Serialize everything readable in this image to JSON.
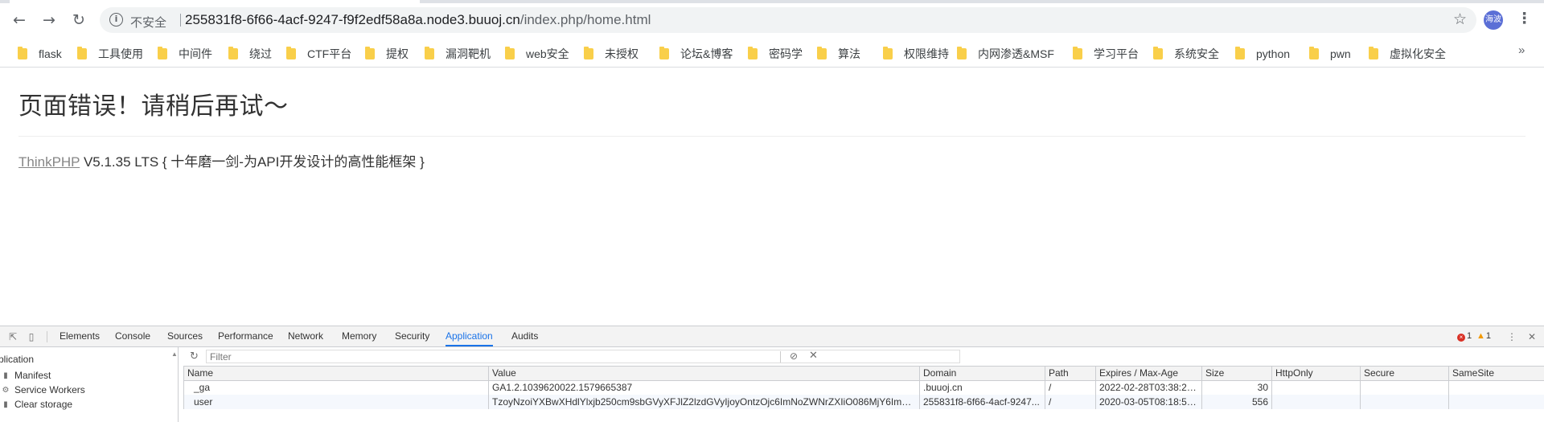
{
  "browser": {
    "omnibox": {
      "security_label": "不安全",
      "host": "255831f8-6f66-4acf-9247-f9f2edf58a8a.node3.buuoj.cn",
      "path": "/index.php/home.html"
    },
    "avatar_text": "海波"
  },
  "bookmarks": [
    "flask",
    "工具使用",
    "中间件",
    "绕过",
    "CTF平台",
    "提权",
    "漏洞靶机",
    "web安全",
    "未授权",
    "论坛&博客",
    "密码学",
    "算法",
    "权限维持",
    "内网渗透&MSF",
    "学习平台",
    "系统安全",
    "python",
    "pwn",
    "虚拟化安全"
  ],
  "page": {
    "title": "页面错误！请稍后再试～",
    "framework_link": "ThinkPHP",
    "version_text": " V5.1.35 LTS { 十年磨一剑-为API开发设计的高性能框架 }"
  },
  "devtools": {
    "tabs": [
      "Elements",
      "Console",
      "Sources",
      "Performance",
      "Network",
      "Memory",
      "Security",
      "Application",
      "Audits"
    ],
    "active_tab": "Application",
    "error_count": "1",
    "warning_count": "1",
    "sidebar": {
      "section_title": "plication",
      "items": [
        {
          "label": "Manifest",
          "icon": "document-icon"
        },
        {
          "label": "Service Workers",
          "icon": "gear-icon"
        },
        {
          "label": "Clear storage",
          "icon": "database-icon"
        }
      ]
    },
    "filter_placeholder": "Filter",
    "cookies": {
      "columns": [
        "Name",
        "Value",
        "Domain",
        "Path",
        "Expires / Max-Age",
        "Size",
        "HttpOnly",
        "Secure",
        "SameSite"
      ],
      "rows": [
        [
          "_ga",
          "GA1.2.1039620022.1579665387",
          ".buuoj.cn",
          "/",
          "2022-02-28T03:38:28....",
          "30",
          "",
          "",
          ""
        ],
        [
          "user",
          "TzoyNzoiYXBwXHdlYlxjb250cm9sbGVyXFJlZ2lzdGVyIjoyOntzOjc6ImNoZWNrZXIiO086MjY6ImFwcF...",
          "255831f8-6f66-4acf-9247...",
          "/",
          "2020-03-05T08:18:59....",
          "556",
          "",
          "",
          ""
        ]
      ]
    }
  }
}
